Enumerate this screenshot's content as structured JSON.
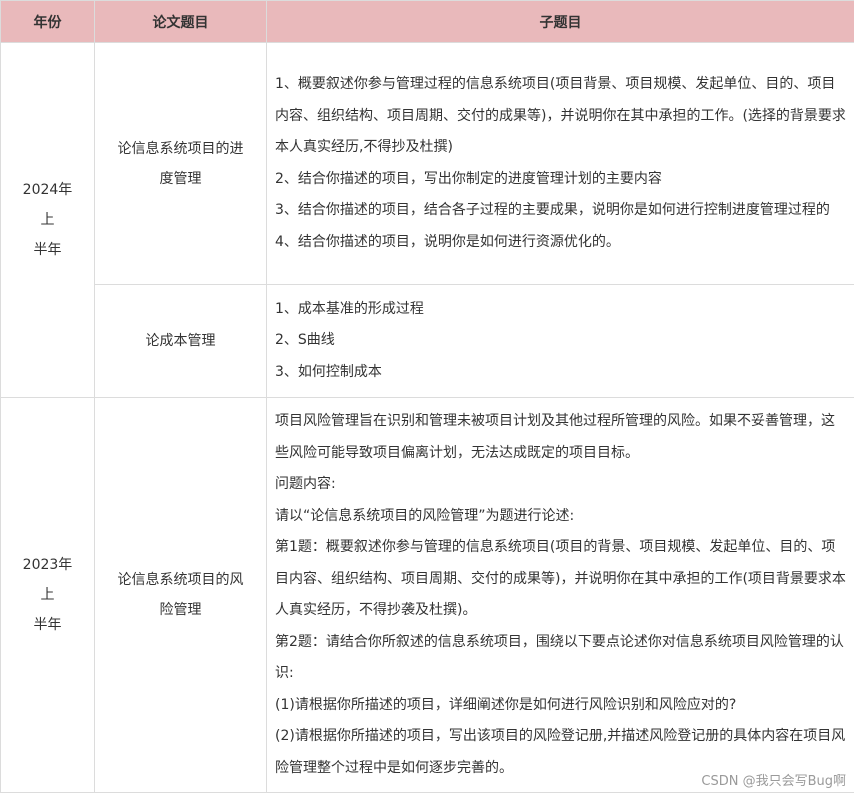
{
  "header": {
    "year": "年份",
    "topic": "论文题目",
    "subtopic": "子题目"
  },
  "rows": [
    {
      "year": "2024年上半年",
      "year_lines": [
        "2024年上",
        "半年"
      ],
      "topics": [
        {
          "title_lines": [
            "论信息系统项目的进",
            "度管理"
          ],
          "items": [
            "1、概要叙述你参与管理过程的信息系统项目(项目背景、项目规模、发起单位、目的、项目内容、组织结构、项目周期、交付的成果等)，并说明你在其中承担的工作。(选择的背景要求本人真实经历,不得抄及杜撰)",
            "2、结合你描述的项目，写出你制定的进度管理计划的主要内容",
            "3、结合你描述的项目，结合各子过程的主要成果，说明你是如何进行控制进度管理过程的",
            "4、结合你描述的项目，说明你是如何进行资源优化的。"
          ]
        },
        {
          "title_lines": [
            "论成本管理"
          ],
          "items": [
            "1、成本基准的形成过程",
            "2、S曲线",
            "3、如何控制成本"
          ]
        }
      ]
    },
    {
      "year": "2023年上半年",
      "year_lines": [
        "2023年上",
        "半年"
      ],
      "topics": [
        {
          "title_lines": [
            "论信息系统项目的风",
            "险管理"
          ],
          "items": [
            "项目风险管理旨在识别和管理未被项目计划及其他过程所管理的风险。如果不妥善管理，这些风险可能导致项目偏离计划，无法达成既定的项目目标。",
            "问题内容:",
            "请以“论信息系统项目的风险管理”为题进行论述:",
            "第1题：概要叙述你参与管理的信息系统项目(项目的背景、项目规模、发起单位、目的、项目内容、组织结构、项目周期、交付的成果等)，并说明你在其中承担的工作(项目背景要求本人真实经历，不得抄袭及杜撰)。",
            "第2题：请结合你所叙述的信息系统项目，围绕以下要点论述你对信息系统项目风险管理的认识:",
            "(1)请根据你所描述的项目，详细阐述你是如何进行风险识别和风险应对的?",
            "(2)请根据你所描述的项目，写出该项目的风险登记册,并描述风险登记册的具体内容在项目风险管理整个过程中是如何逐步完善的。"
          ]
        }
      ]
    }
  ],
  "watermark": "CSDN @我只会写Bug啊"
}
